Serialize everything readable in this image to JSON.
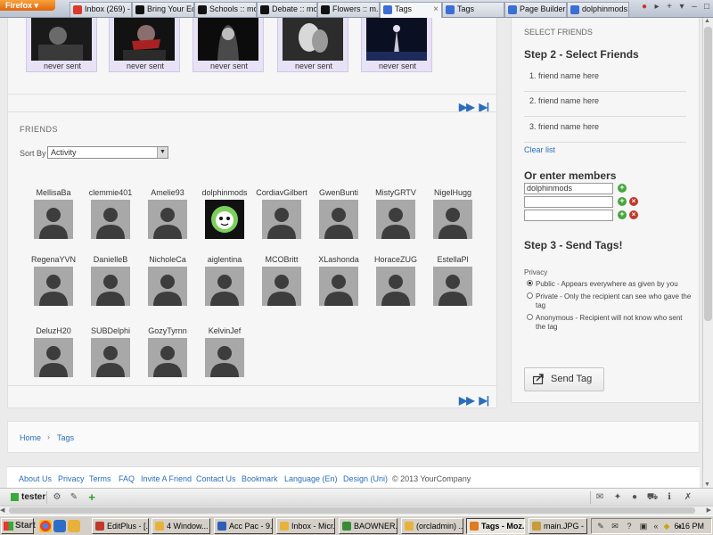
{
  "browser": {
    "app_button": "Firefox",
    "tabs": [
      {
        "label": "Inbox (269) - ...",
        "color": "#d93a2b",
        "close": ""
      },
      {
        "label": "Bring Your Ed...",
        "color": "#111111",
        "close": ""
      },
      {
        "label": "Schools :: mo...",
        "color": "#111111",
        "close": ""
      },
      {
        "label": "Debate :: mo...",
        "color": "#111111",
        "close": ""
      },
      {
        "label": "Flowers :: m...",
        "color": "#111111",
        "close": ""
      },
      {
        "label": "Tags",
        "color": "#3b6fd6",
        "close": "×"
      },
      {
        "label": "Tags",
        "color": "#3b6fd6",
        "close": ""
      },
      {
        "label": "Page Builder",
        "color": "#3b6fd6",
        "close": ""
      },
      {
        "label": "dolphinmods:...",
        "color": "#3b6fd6",
        "close": ""
      }
    ]
  },
  "gifts": {
    "items": [
      {
        "status": "never sent"
      },
      {
        "status": "never sent"
      },
      {
        "status": "never sent"
      },
      {
        "status": "never sent"
      },
      {
        "status": "never sent"
      }
    ]
  },
  "friends": {
    "title": "FRIENDS",
    "sort_label": "Sort By",
    "sort_value": "Activity",
    "rows": [
      [
        "MellisaBa",
        "clemmie401",
        "Amelie93",
        "dolphinmods",
        "CordiavGilbert",
        "GwenBunti",
        "MistyGRTV",
        "NigelHugg"
      ],
      [
        "RegenaYVN",
        "DanielleB",
        "NicholeCa",
        "aiglentina",
        "MCOBritt",
        "XLashonda",
        "HoraceZUG",
        "EstellaPl"
      ],
      [
        "DeluzH20",
        "SUBDelphi",
        "GozyTyrnn",
        "KelvinJef"
      ]
    ],
    "custom_avatar_user": "dolphinmods"
  },
  "sidebar": {
    "select_friends_label": "SELECT FRIENDS",
    "step2_heading": "Step 2 - Select Friends",
    "slots": [
      "1. friend name here",
      "2. friend name here",
      "3. friend name here"
    ],
    "clear_list": "Clear list",
    "members_heading": "Or enter members",
    "member_inputs": [
      "dolphinmods",
      "",
      ""
    ],
    "step3_heading": "Step 3 - Send Tags!",
    "privacy_label": "Privacy",
    "privacy_options": [
      {
        "label": "Public - Appears everywhere as given by you",
        "selected": true
      },
      {
        "label": "Private - Only the recipient can see who gave the tag",
        "selected": false
      },
      {
        "label": "Anonymous - Recipient will not know who sent the tag",
        "selected": false
      }
    ],
    "send_button": "Send Tag"
  },
  "breadcrumb": {
    "items": [
      "Home",
      "Tags"
    ],
    "separator": "›"
  },
  "footer": {
    "links": [
      "About Us",
      "Privacy",
      "Terms",
      "FAQ",
      "Invite A Friend",
      "Contact Us",
      "Bookmark",
      "Language (En)",
      "Design (Uni)"
    ],
    "copyright": "© 2013 YourCompany"
  },
  "site_toolbar": {
    "username": "tester"
  },
  "taskbar": {
    "start": "Start",
    "tasks": [
      {
        "label": "EditPlus - [...",
        "color": "#c0392b",
        "active": false
      },
      {
        "label": "4 Window...",
        "color": "#e8b23a",
        "active": false
      },
      {
        "label": "Acc Pac - 9...",
        "color": "#2e5fb8",
        "active": false
      },
      {
        "label": "Inbox - Micr...",
        "color": "#e8b23a",
        "active": false
      },
      {
        "label": "BAOWNER...",
        "color": "#3a8a3a",
        "active": false
      },
      {
        "label": "(orcladmin) ...",
        "color": "#e8b23a",
        "active": false
      },
      {
        "label": "Tags - Moz...",
        "color": "#e07b1f",
        "active": true
      },
      {
        "label": "main.JPG - ...",
        "color": "#c99a3c",
        "active": false
      }
    ],
    "clock": "6:16 PM"
  }
}
